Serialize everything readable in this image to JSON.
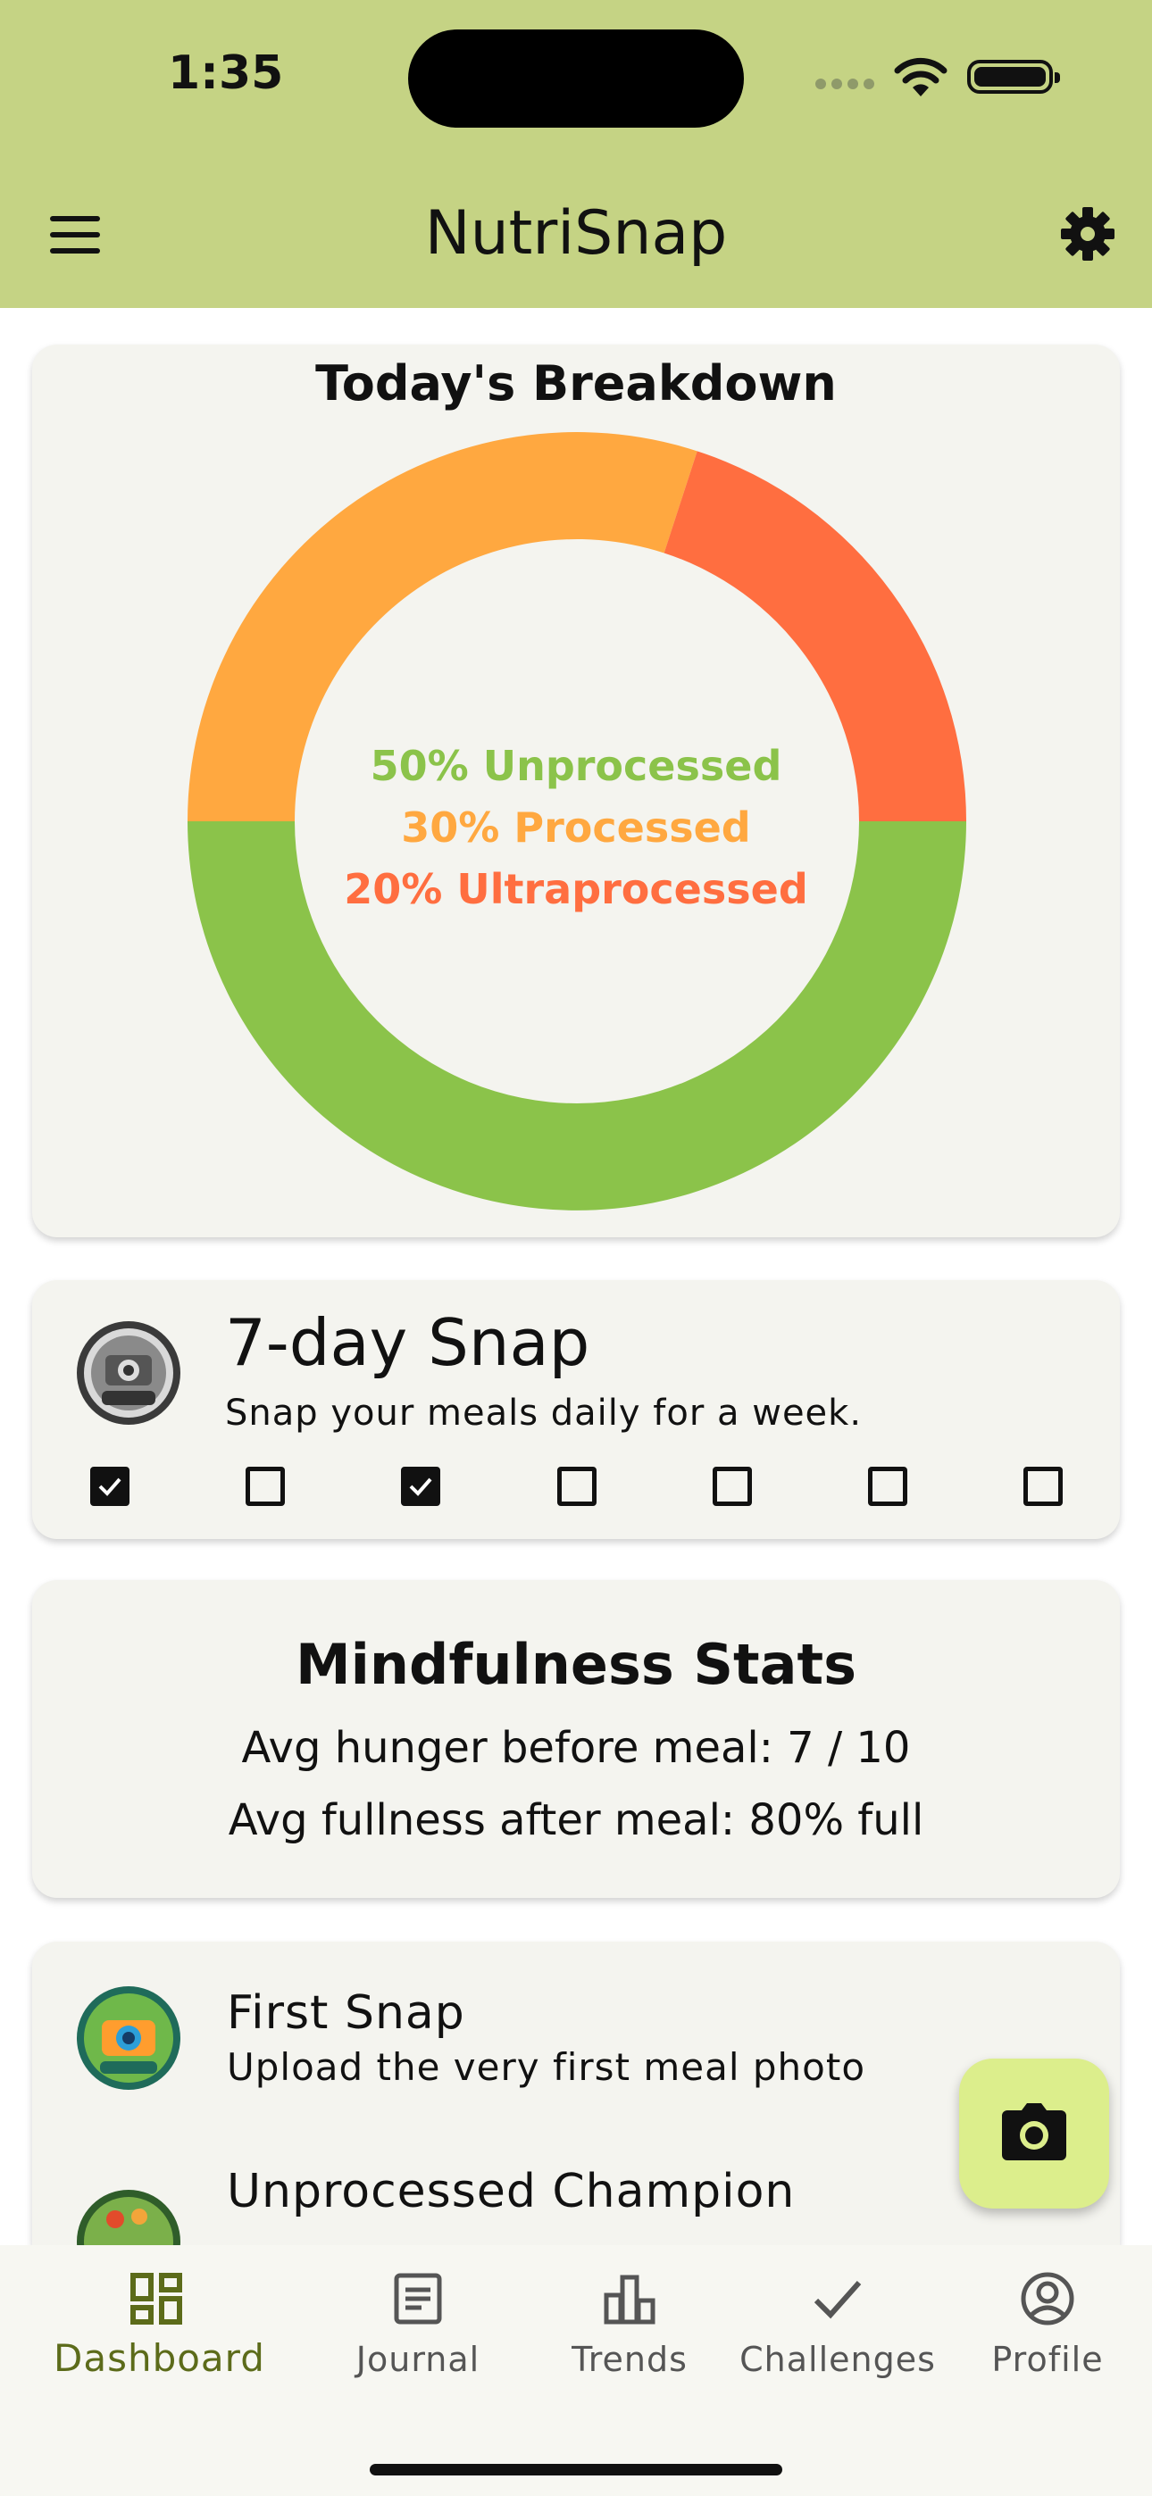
{
  "status_bar": {
    "time": "1:35"
  },
  "app_bar": {
    "title": "NutriSnap",
    "menu_icon": "menu-icon",
    "settings_icon": "gear-icon"
  },
  "breakdown": {
    "title": "Today's Breakdown",
    "labels": [
      "50% Unprocessed",
      "30% Processed",
      "20% Ultraprocessed"
    ]
  },
  "chart_data": {
    "type": "pie",
    "title": "Today's Breakdown",
    "categories": [
      "Unprocessed",
      "Processed",
      "Ultraprocessed"
    ],
    "values": [
      50,
      30,
      20
    ],
    "colors": [
      "#8bc34a",
      "#ffa840",
      "#ff6e40"
    ],
    "style": "donut"
  },
  "challenge": {
    "title": "7-day Snap",
    "description": "Snap your meals daily for a week.",
    "days_checked": [
      true,
      false,
      true,
      false,
      false,
      false,
      false
    ],
    "badge_icon": "snap-challenge-badge-icon"
  },
  "mindfulness": {
    "title": "Mindfulness Stats",
    "hunger": "Avg hunger before meal: 7 / 10",
    "fullness": "Avg fullness after meal: 80% full"
  },
  "achievements": [
    {
      "title": "First Snap",
      "description": "Upload the very first meal photo",
      "icon": "first-snap-badge-icon"
    },
    {
      "title": "Unprocessed Champion",
      "description": "",
      "icon": "unprocessed-champion-badge-icon"
    }
  ],
  "fab": {
    "icon": "camera-icon"
  },
  "nav": {
    "items": [
      {
        "label": "Dashboard",
        "icon": "dashboard-icon",
        "active": true
      },
      {
        "label": "Journal",
        "icon": "journal-icon",
        "active": false
      },
      {
        "label": "Trends",
        "icon": "trends-icon",
        "active": false
      },
      {
        "label": "Challenges",
        "icon": "checkmark-icon",
        "active": false
      },
      {
        "label": "Profile",
        "icon": "profile-icon",
        "active": false
      }
    ]
  },
  "colors": {
    "app_bar": "#c5d384",
    "card": "#f4f4ef",
    "unprocessed": "#8bc34a",
    "processed": "#ffa840",
    "ultraprocessed": "#ff6e40",
    "fab": "#dcee8c",
    "nav_active": "#5c6b1a"
  }
}
